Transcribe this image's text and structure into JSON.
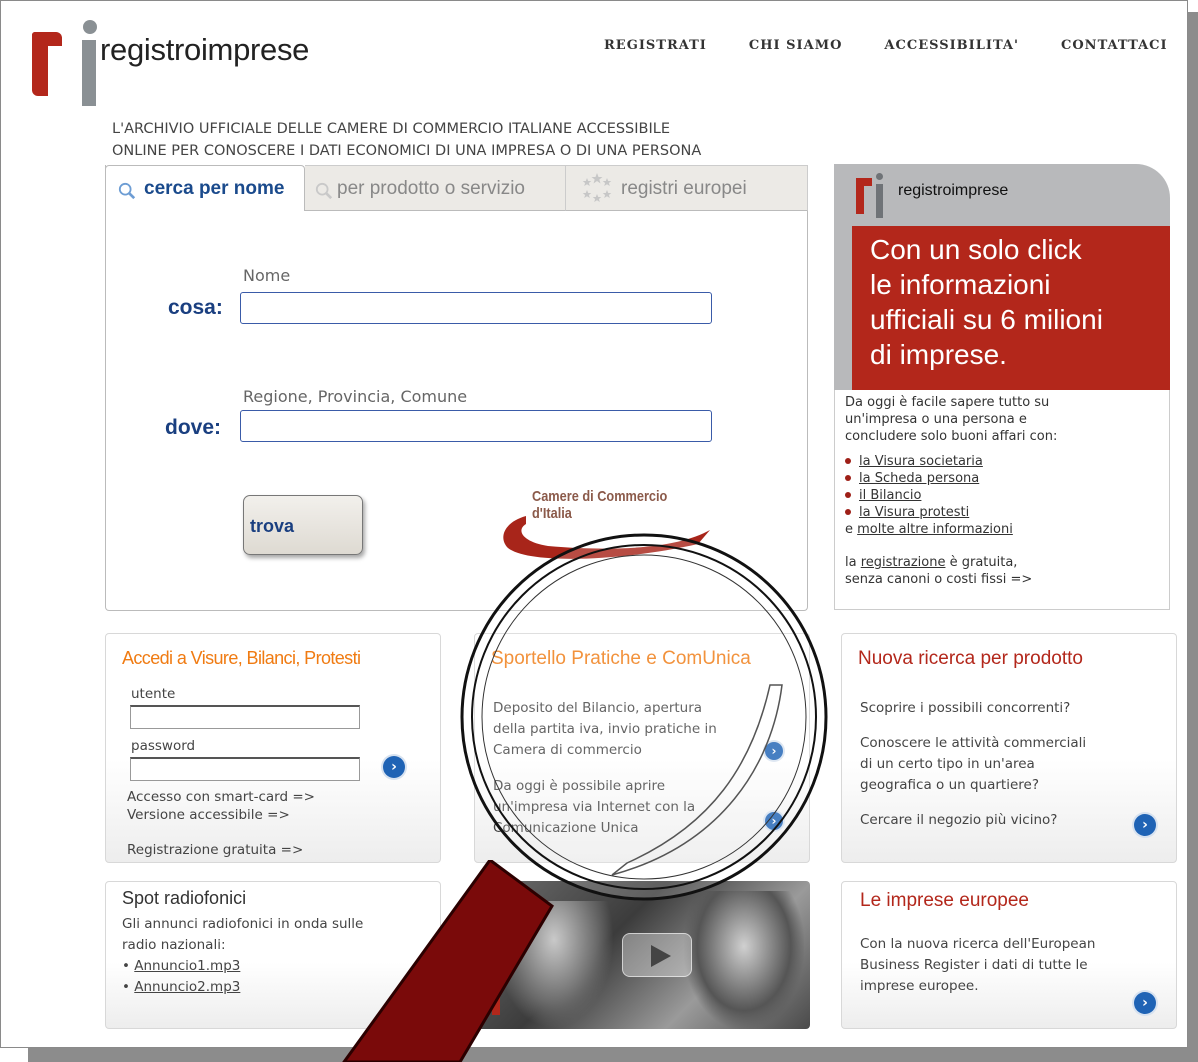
{
  "brand": "registroimprese",
  "nav": [
    "REGISTRATI",
    "CHI SIAMO",
    "ACCESSIBILITA'",
    "CONTATTACI"
  ],
  "tagline": [
    "L'ARCHIVIO UFFICIALE DELLE CAMERE DI COMMERCIO ITALIANE ACCESSIBILE",
    "ONLINE PER CONOSCERE I DATI ECONOMICI DI UNA IMPRESA O DI UNA PERSONA"
  ],
  "search": {
    "tabs": [
      "cerca per nome",
      "per prodotto o servizio",
      "registri europei"
    ],
    "cosa_label": "cosa:",
    "cosa_hint": "Nome",
    "cosa_value": "",
    "dove_label": "dove:",
    "dove_hint": "Regione, Provincia, Comune",
    "dove_value": "",
    "button": "trova",
    "logo_text": [
      "Camere di Commercio",
      "d'Italia"
    ]
  },
  "ad": {
    "brand": "registroimprese",
    "headline": [
      "Con un solo click",
      "le informazioni",
      "ufficiali su 6 milioni",
      "di imprese."
    ],
    "intro": [
      "Da oggi è facile sapere tutto su",
      "un'impresa o una persona e",
      "concludere solo buoni affari con:"
    ],
    "items": [
      "la Visura societaria",
      "la Scheda persona",
      "il Bilancio",
      "la Visura protesti"
    ],
    "more_prefix": "e ",
    "more_link": "molte altre informazioni",
    "reg_prefix": "la ",
    "reg_link": "registrazione",
    "reg_suffix": " è gratuita,",
    "reg_line2": "senza canoni o costi fissi =>"
  },
  "access": {
    "title": "Accedi a Visure, Bilanci, Protesti",
    "user_label": "utente",
    "user_value": "",
    "pass_label": "password",
    "pass_value": "",
    "smartcard": "Accesso con smart-card =>",
    "accessible": "Versione accessibile =>",
    "signup": "Registrazione gratuita =>"
  },
  "sportello": {
    "title": "Sportello Pratiche e ComUnica",
    "text1": [
      "Deposito del Bilancio, apertura",
      "della partita iva, invio pratiche in",
      "Camera di commercio"
    ],
    "text2": [
      "Da oggi è possibile aprire",
      "un'impresa via Internet con la",
      "Comunicazione Unica"
    ]
  },
  "prodotto": {
    "title": "Nuova ricerca per prodotto",
    "q1": "Scoprire i possibili concorrenti?",
    "q2": [
      "Conoscere le attività commerciali",
      "di un certo tipo in un'area",
      "geografica o un quartiere?"
    ],
    "q3": "Cercare il negozio più vicino?"
  },
  "spot": {
    "title": "Spot radiofonici",
    "text": [
      "Gli annunci radiofonici in onda sulle",
      "radio nazionali:"
    ],
    "files": [
      "Annuncio1.mp3",
      "Annuncio2.mp3"
    ]
  },
  "europee": {
    "title": "Le imprese europee",
    "text": [
      "Con la nuova ricerca dell'European",
      "Business Register i dati di tutte le",
      "imprese europee."
    ]
  },
  "colors": {
    "accent_red": "#b3271b",
    "accent_orange": "#f07b12",
    "link_blue": "#1a3f80",
    "arrow_blue": "#1f63b5"
  },
  "icons": [
    "search-icon",
    "stars-icon",
    "arrow-right-icon",
    "play-icon",
    "magnifier-icon"
  ]
}
